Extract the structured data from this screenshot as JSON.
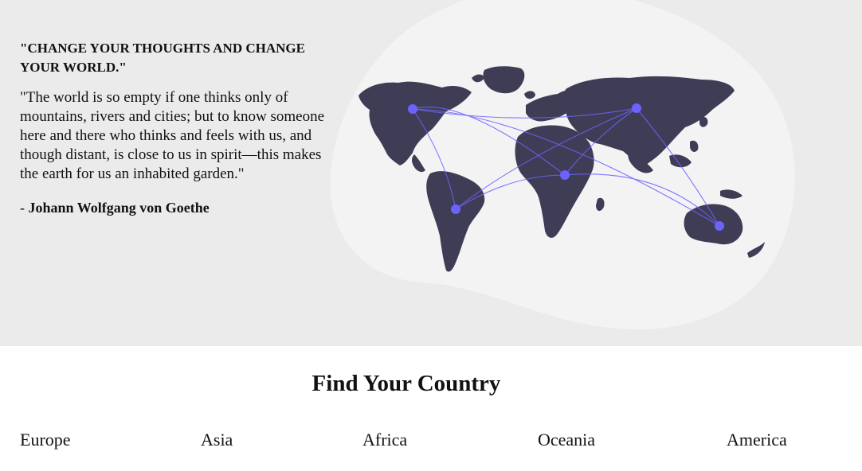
{
  "hero": {
    "heading": "\"CHANGE YOUR THOUGHTS AND CHANGE YOUR WORLD.\"",
    "body": "\"The world is so empty if one thinks only of mountains, rivers and cities; but to know someone here and there who thinks and feels with us, and though distant, is close to us in spirit—this makes the earth for us an inhabited garden.\"",
    "author_prefix": "- ",
    "author_name": "Johann Wolfgang von Goethe",
    "illustration": "world-map-network-icon",
    "colors": {
      "background": "#ebebeb",
      "blob": "#f3f3f4",
      "continents": "#3f3d56",
      "accent": "#6c63ff"
    }
  },
  "find": {
    "title": "Find Your Country",
    "regions": [
      "Europe",
      "Asia",
      "Africa",
      "Oceania",
      "America"
    ]
  }
}
